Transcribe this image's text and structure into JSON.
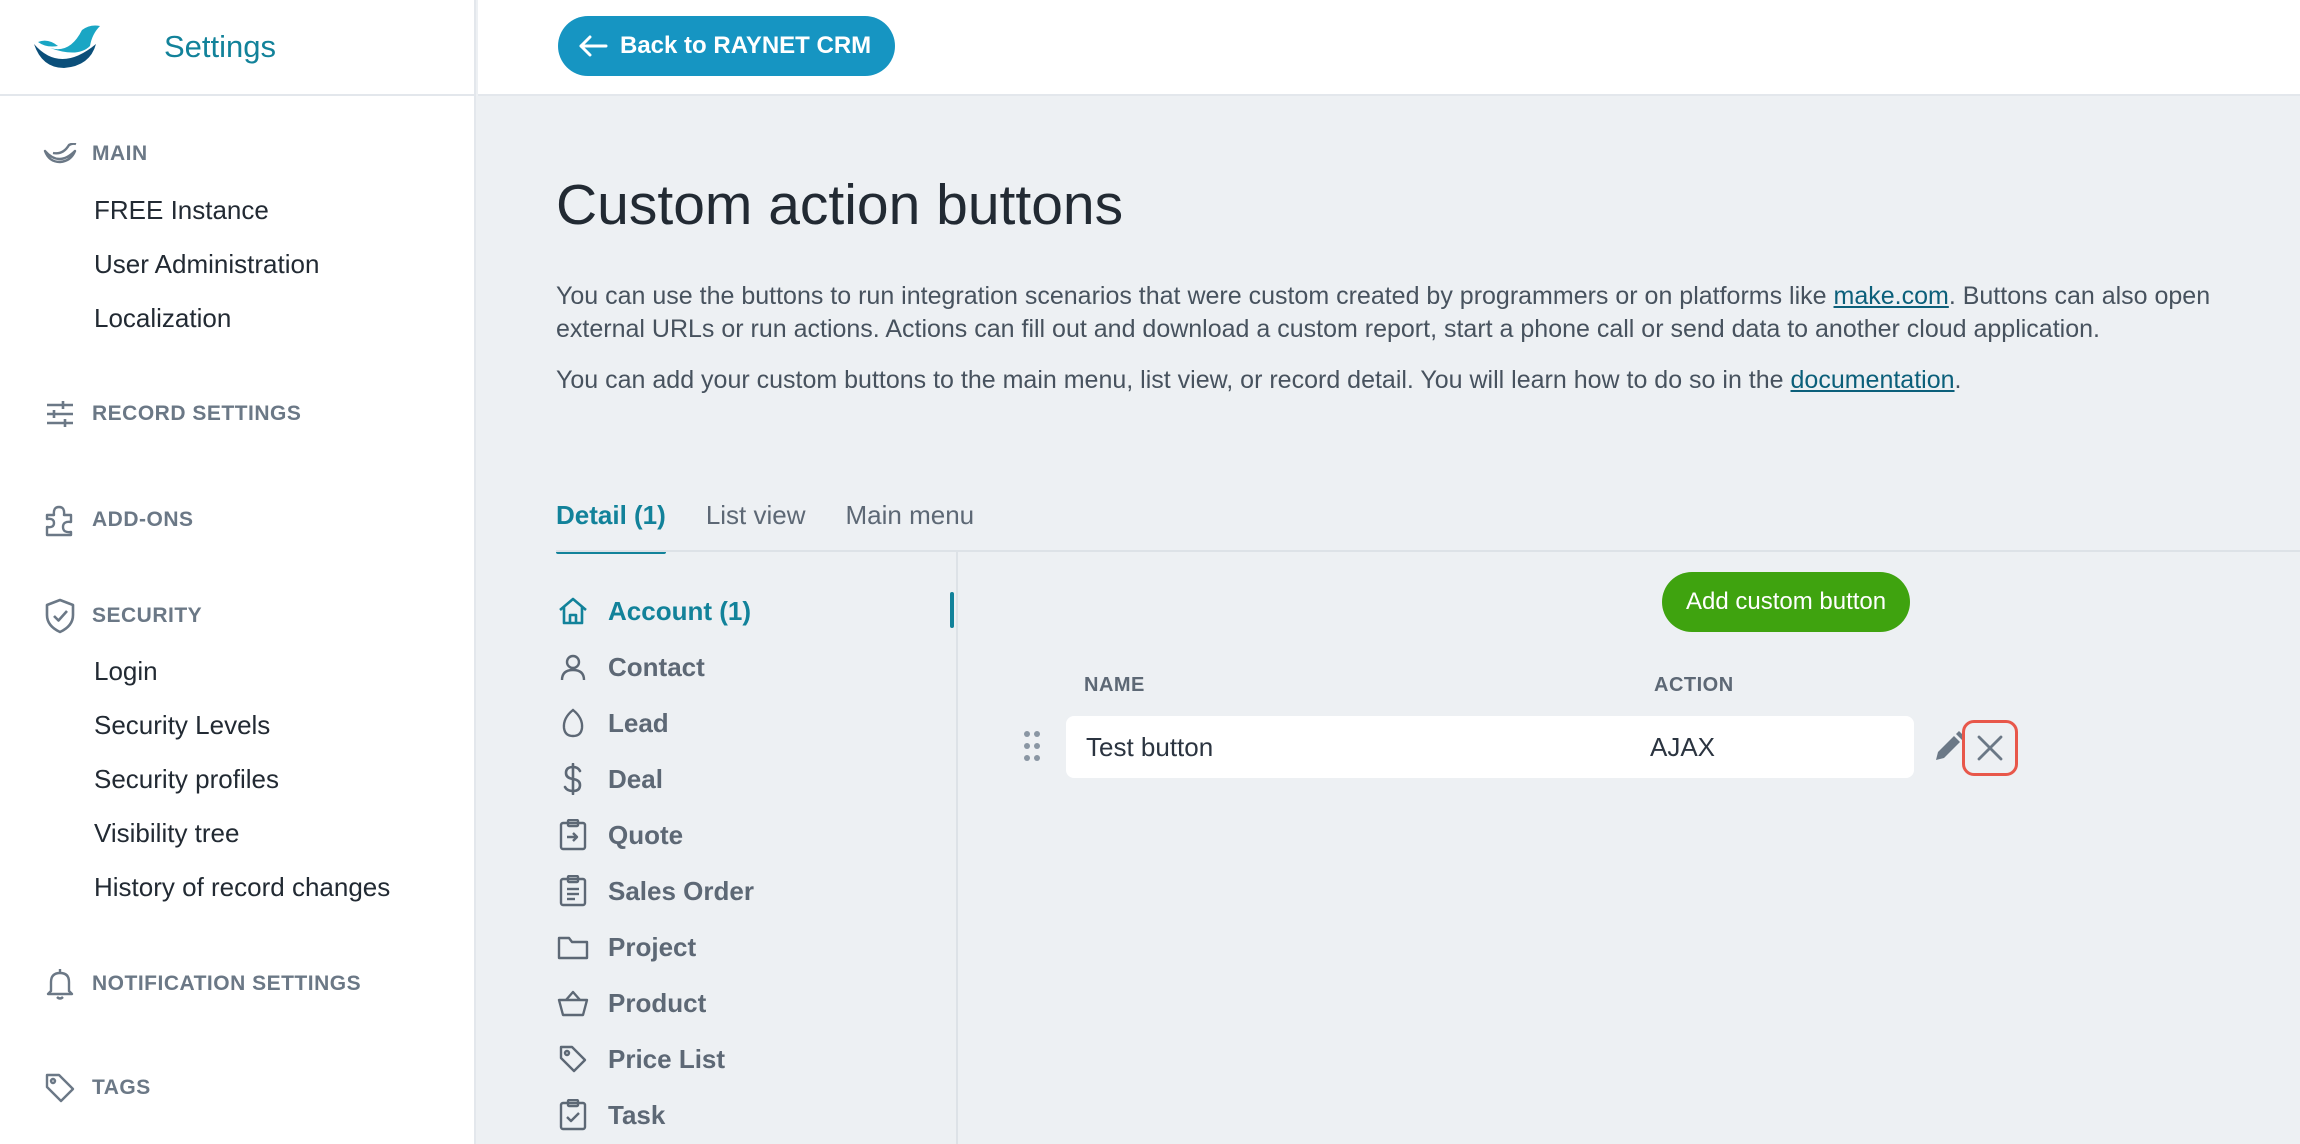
{
  "sidebar": {
    "title": "Settings",
    "sections": {
      "main": "MAIN",
      "record_settings": "RECORD SETTINGS",
      "addons": "ADD-ONS",
      "security": "SECURITY",
      "notification_settings": "NOTIFICATION SETTINGS",
      "tags": "TAGS"
    },
    "main_items": [
      "FREE Instance",
      "User Administration",
      "Localization"
    ],
    "security_items": [
      "Login",
      "Security Levels",
      "Security profiles",
      "Visibility tree",
      "History of record changes"
    ]
  },
  "topbar": {
    "back_label": "Back to RAYNET CRM"
  },
  "page": {
    "title": "Custom action buttons",
    "desc1_part1": "You can use the buttons to run integration scenarios that were custom created by programmers or on platforms like ",
    "desc1_link": "make.com",
    "desc1_part2": ". Buttons can also open external URLs or run actions. Actions can fill out and download a custom report, start a phone call or send data to another cloud application.",
    "desc2_part1": "You can add your custom buttons to the main menu, list view, or record detail. You will learn how to do so in the ",
    "desc2_link": "documentation",
    "desc2_part2": "."
  },
  "tabs": [
    "Detail (1)",
    "List view",
    "Main menu"
  ],
  "entities": [
    "Account (1)",
    "Contact",
    "Lead",
    "Deal",
    "Quote",
    "Sales Order",
    "Project",
    "Product",
    "Price List",
    "Task"
  ],
  "table": {
    "add_label": "Add custom button",
    "col_name": "NAME",
    "col_action": "ACTION",
    "rows": [
      {
        "name": "Test button",
        "action": "AJAX"
      }
    ]
  },
  "colors": {
    "accent": "#12829a",
    "primary_button": "#1695c2",
    "add_button": "#3fa30f",
    "delete_highlight": "#e8574a"
  }
}
